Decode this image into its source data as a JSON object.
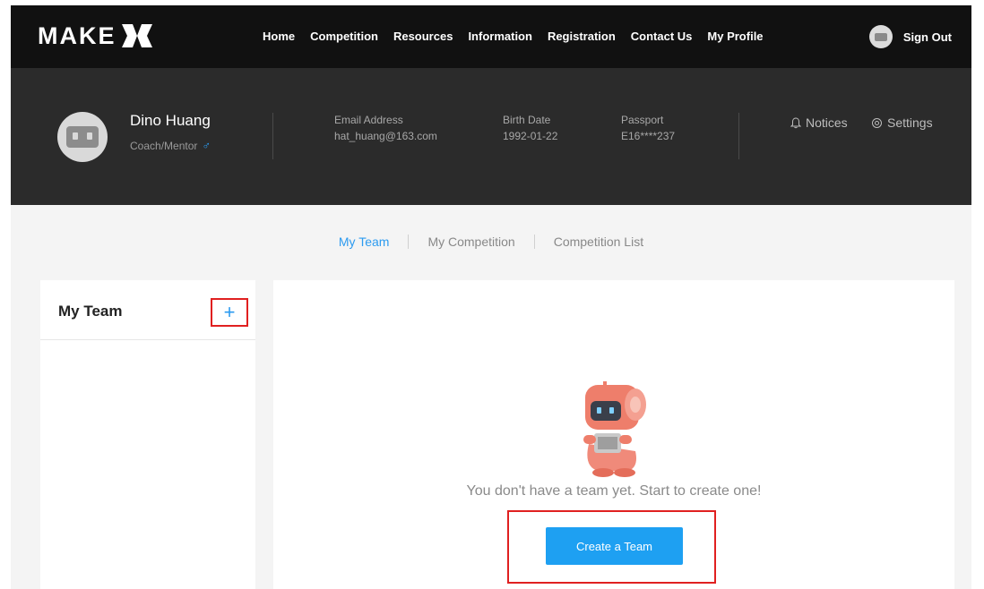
{
  "brand": {
    "logo_text": "MAKE"
  },
  "nav": {
    "links": [
      {
        "label": "Home"
      },
      {
        "label": "Competition"
      },
      {
        "label": "Resources"
      },
      {
        "label": "Information"
      },
      {
        "label": "Registration"
      },
      {
        "label": "Contact Us"
      },
      {
        "label": "My Profile",
        "active": true
      }
    ],
    "sign_out": "Sign Out"
  },
  "profile": {
    "name": "Dino Huang",
    "role": "Coach/Mentor",
    "gender_symbol": "♂",
    "email_label": "Email Address",
    "email_value": "hat_huang@163.com",
    "birth_label": "Birth Date",
    "birth_value": "1992-01-22",
    "passport_label": "Passport",
    "passport_value": "E16****237",
    "notices_label": "Notices",
    "settings_label": "Settings"
  },
  "tabs": [
    {
      "label": "My Team",
      "active": true
    },
    {
      "label": "My Competition"
    },
    {
      "label": "Competition List"
    }
  ],
  "team_panel": {
    "title": "My Team",
    "add_symbol": "+"
  },
  "main": {
    "empty_message": "You don't have a team yet. Start to create one!",
    "create_button": "Create a Team"
  },
  "colors": {
    "accent": "#1ea0f2",
    "highlight": "#e02020",
    "nav_bg": "#111111",
    "profile_bg": "#2b2b2b"
  },
  "icons": {
    "notices": "bell-icon",
    "settings": "gear-icon",
    "add": "plus-icon"
  }
}
